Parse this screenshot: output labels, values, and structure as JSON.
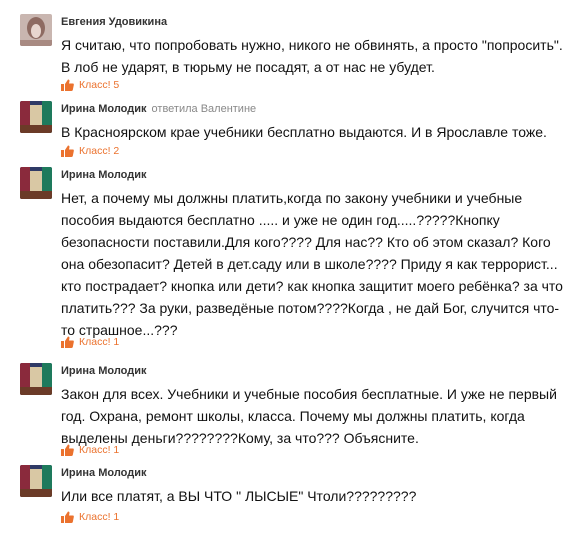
{
  "comments": [
    {
      "author": "Евгения Удовикина",
      "reply_to": "",
      "text": "Я считаю, что попробовать нужно, никого не обвинять, а просто \"попросить\". В лоб не ударят, в тюрьму не посадят, а от нас не убудет.",
      "likes": "Класс! 5"
    },
    {
      "author": "Ирина Молодик",
      "reply_to": "ответила Валентине",
      "text": "В Красноярском крае учебники бесплатно выдаются. И в Ярославле тоже.",
      "likes": "Класс! 2"
    },
    {
      "author": "Ирина Молодик",
      "reply_to": "",
      "text": "Нет, а почему мы должны платить,когда по закону учебники и учебные пособия выдаются бесплатно ..... и уже не один год.....?????Кнопку безопасности поставили.Для кого???? Для нас?? Кто об этом сказал? Кого она обезопасит? Детей в дет.саду или в школе???? Приду я как террорист... кто пострадает? кнопка или дети? как кнопка защитит моего ребёнка? за что платить??? За руки, разведёные потом????Когда , не дай Бог, случится что-то страшное...???",
      "likes": "Класс! 1"
    },
    {
      "author": "Ирина Молодик",
      "reply_to": "",
      "text": "Закон для всех. Учебники и учебные пособия бесплатные. И уже не первый год. Охрана, ремонт школы, класса. Почему мы должны платить, когда выделены деньги????????Кому, за что??? Объясните.",
      "likes": "Класс! 1"
    },
    {
      "author": "Ирина Молодик",
      "reply_to": "",
      "text": "Или все платят, а ВЫ ЧТО \" ЛЫСЫЕ\" Чтоли?????????",
      "likes": "Класс! 1"
    }
  ],
  "icons": {
    "like": "thumbs-up-icon"
  },
  "colors": {
    "accent": "#eb722e",
    "author": "#333333",
    "reply": "#888888",
    "text": "#111111"
  }
}
